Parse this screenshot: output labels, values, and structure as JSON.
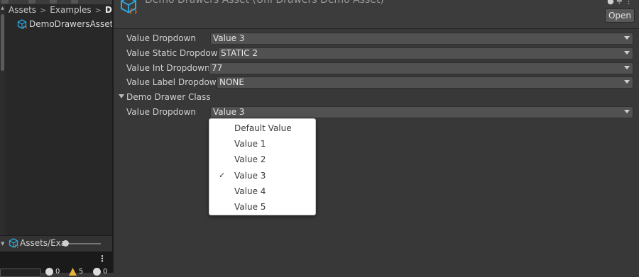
{
  "project": {
    "breadcrumb": [
      "Assets",
      "Examples",
      "Draw"
    ],
    "asset_item": "DemoDrawersAsset",
    "footer_path": "Assets/Exa",
    "console_counts": [
      "0",
      "5",
      "0"
    ]
  },
  "inspector": {
    "title": "Demo Drawers Asset (Uni Drawers Demo Asset)",
    "open_label": "Open",
    "properties": [
      {
        "label": "Value Dropdown",
        "value": "Value 3"
      },
      {
        "label": "Value Static Dropdown",
        "value": "STATIC 2"
      },
      {
        "label": "Value Int Dropdown",
        "value": "77"
      },
      {
        "label": "Value Label Dropdown",
        "value": "NONE"
      }
    ],
    "foldout": {
      "label": "Demo Drawer Class",
      "property": {
        "label": "Value Dropdown",
        "value": "Value 3"
      }
    }
  },
  "dropdown_popup": {
    "options": [
      "Default Value",
      "Value 1",
      "Value 2",
      "Value 3",
      "Value 4",
      "Value 5"
    ],
    "selected": "Value 3",
    "check_mark": "✓"
  },
  "colors": {
    "panel_bg": "#383838",
    "field_bg": "#515151",
    "popup_bg": "#ffffff",
    "asset_icon_blue": "#2aa8e0",
    "asset_icon_orange": "#f07a2a",
    "warning_yellow": "#e8b53a"
  },
  "icons": {
    "asset": "scriptable-object-icon",
    "info": "info-icon",
    "warning": "warning-icon",
    "error": "error-icon",
    "menu": "kebab-menu-icon"
  }
}
